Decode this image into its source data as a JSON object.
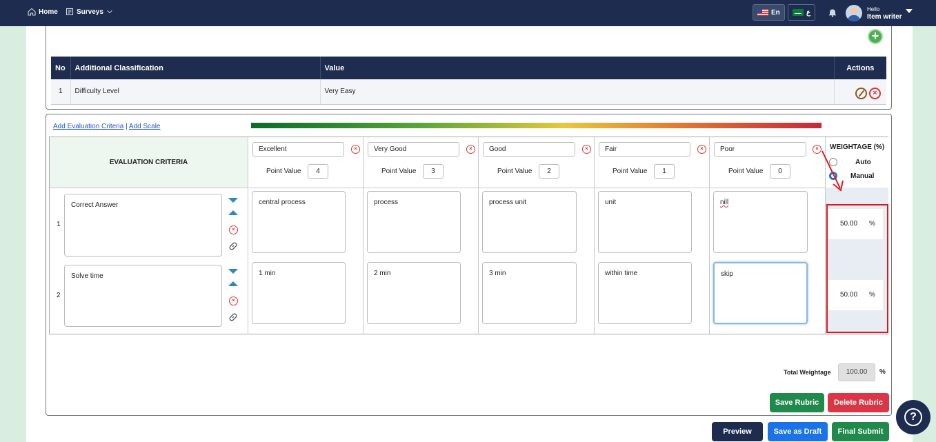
{
  "topbar": {
    "home_label": "Home",
    "surveys_label": "Surveys",
    "lang_en": "En",
    "lang_ar": "ع",
    "hello": "Hello",
    "user_name": "Item writer"
  },
  "classification_table": {
    "headers": {
      "no": "No",
      "classification": "Additional Classification",
      "value": "Value",
      "actions": "Actions"
    },
    "rows": [
      {
        "no": "1",
        "classification": "Difficulty Level",
        "value": "Very Easy"
      }
    ]
  },
  "rubric": {
    "add_criteria_link": "Add Evaluation Criteria",
    "separator": "|",
    "add_scale_link": "Add Scale",
    "criteria_header": "EVALUATION CRITERIA",
    "point_value_label": "Point Value",
    "scales": [
      {
        "name": "Excellent",
        "point_value": "4"
      },
      {
        "name": "Very Good",
        "point_value": "3"
      },
      {
        "name": "Good",
        "point_value": "2"
      },
      {
        "name": "Fair",
        "point_value": "1"
      },
      {
        "name": "Poor",
        "point_value": "0"
      }
    ],
    "weightage_header": "WEIGHTAGE (%)",
    "auto_label": "Auto",
    "manual_label": "Manual",
    "criteria": [
      {
        "no": "1",
        "name": "Correct Answer",
        "descriptors": [
          "central process",
          "process",
          "process unit",
          "unit",
          "nill"
        ],
        "weight": "50.00",
        "pct": "%"
      },
      {
        "no": "2",
        "name": "Solve time",
        "descriptors": [
          "1 min",
          "2 min",
          "3 min",
          "within time",
          "skip"
        ],
        "weight": "50.00",
        "pct": "%"
      }
    ],
    "total_label": "Total Weightage",
    "total_value": "100.00",
    "total_pct": "%"
  },
  "buttons": {
    "save_rubric": "Save Rubric",
    "delete_rubric": "Delete Rubric",
    "preview": "Preview",
    "save_draft": "Save as Draft",
    "final_submit": "Final Submit"
  },
  "colors": {
    "navy": "#1e2d4f",
    "green": "#1f8a4c",
    "red": "#dc3545",
    "blue": "#1a73e8",
    "annotation": "#e0161c"
  }
}
